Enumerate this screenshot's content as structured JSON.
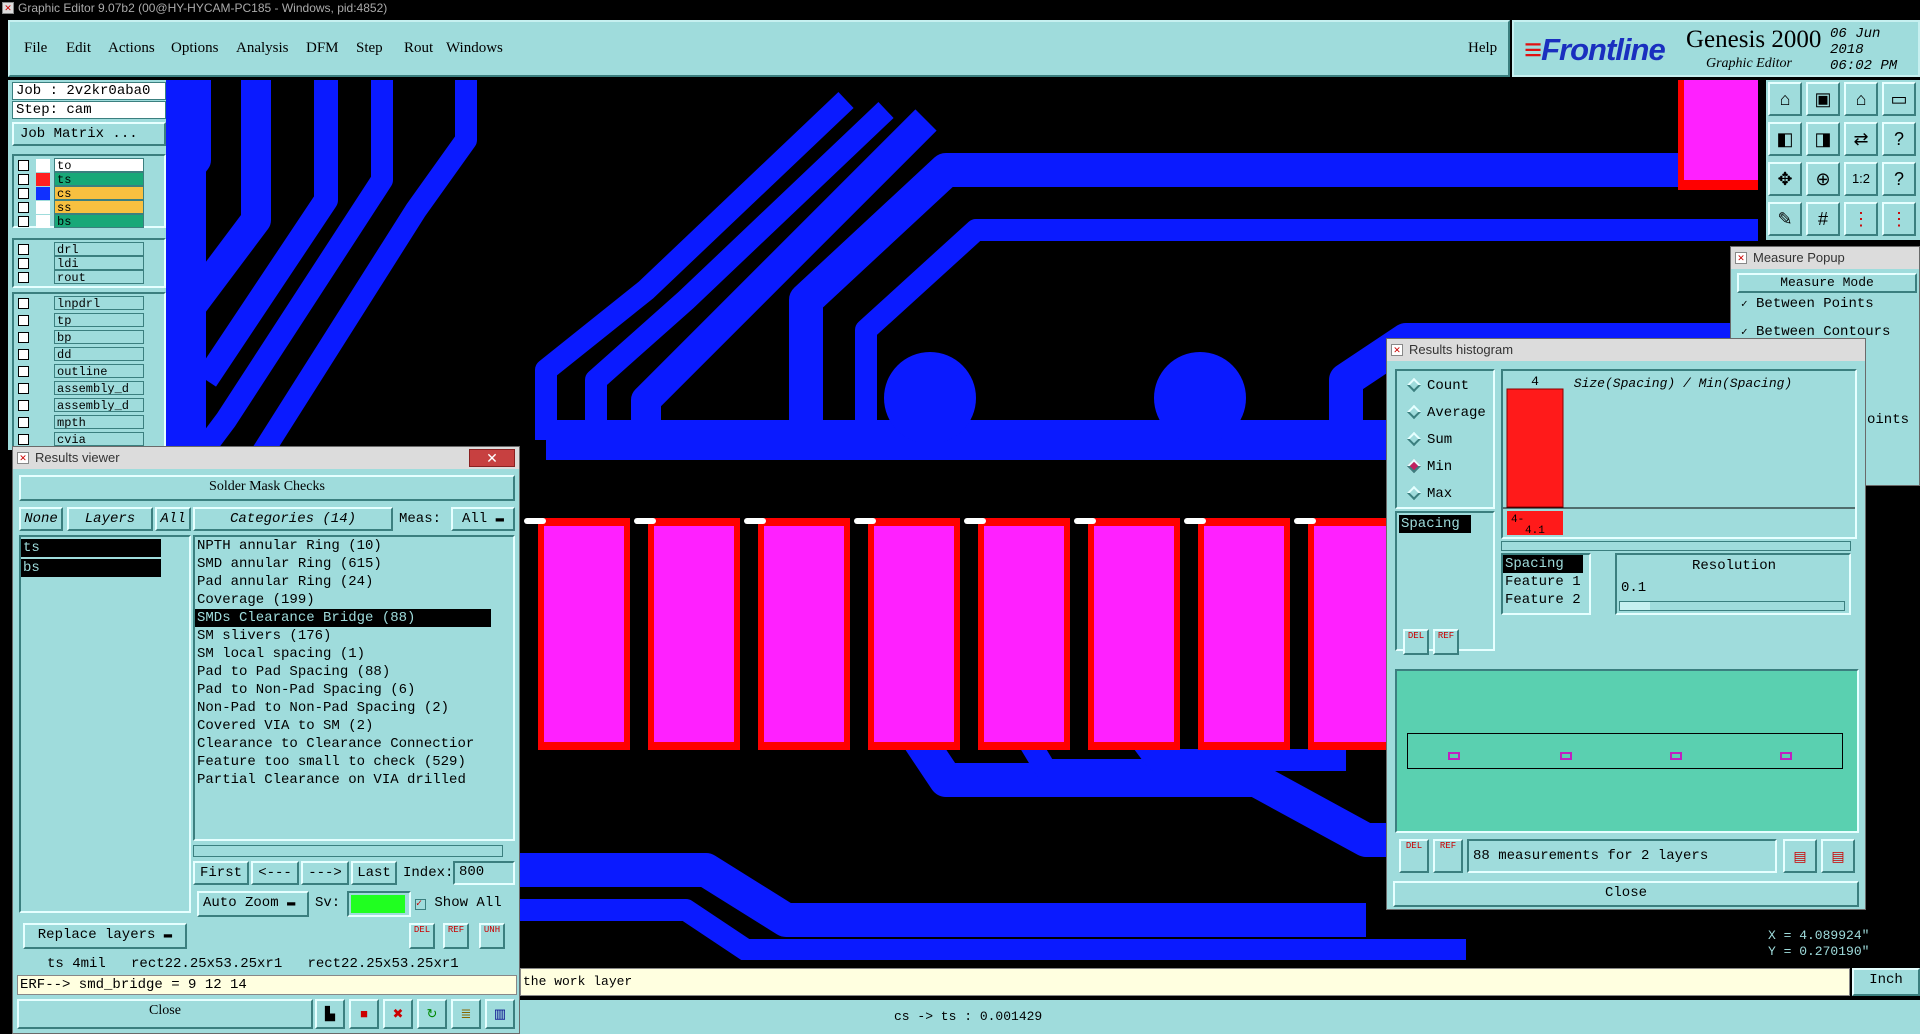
{
  "window_title": "Graphic Editor 9.07b2 (00@HY-HYCAM-PC185 - Windows, pid:4852)",
  "menu": [
    "File",
    "Edit",
    "Actions",
    "Options",
    "Analysis",
    "DFM",
    "Step",
    "Rout",
    "Windows"
  ],
  "help": "Help",
  "brand": {
    "logo": "Frontline",
    "product": "Genesis 2000",
    "subtitle": "Graphic Editor",
    "date": "06 Jun 2018",
    "time": "06:02 PM"
  },
  "job": {
    "job_label": "Job : 2v2kr0aba0",
    "step_label": "Step: cam",
    "matrix_button": "Job Matrix ..."
  },
  "layers_group1": [
    {
      "name": "to",
      "color": "#ffffff",
      "swatch": "#ffffff",
      "row": "#ffffff"
    },
    {
      "name": "ts",
      "color": "#ff0000",
      "swatch": "#ff2020",
      "row": "#18a878"
    },
    {
      "name": "cs",
      "color": "#0000ff",
      "swatch": "#1030ff",
      "row": "#f8c040"
    },
    {
      "name": "ss",
      "color": "#ffff00",
      "swatch": "#ffffff",
      "row": "#f8c040"
    },
    {
      "name": "bs",
      "color": "#18a878",
      "swatch": "#ffffff",
      "row": "#18a878"
    }
  ],
  "layers_group2": [
    "drl",
    "ldi",
    "rout"
  ],
  "layers_group3": [
    "lnpdrl",
    "tp",
    "bp",
    "dd",
    "outline",
    "assembly_d",
    "assembly_d",
    "mpth",
    "cvia"
  ],
  "results_viewer": {
    "title": "Results viewer",
    "header": "Solder Mask Checks",
    "none_btn": "None",
    "layers_btn": "Layers",
    "all_btn": "All",
    "layers": [
      "ts",
      "bs"
    ],
    "categories_label": "Categories (14)",
    "meas_label": "Meas:",
    "meas_value": "All",
    "categories": [
      "NPTH annular Ring (10)",
      "SMD annular Ring (615)",
      "Pad annular Ring (24)",
      "Coverage (199)",
      "SMDs Clearance Bridge (88)",
      "SM slivers (176)",
      "SM local spacing (1)",
      "Pad to Pad Spacing (88)",
      "Pad to Non-Pad Spacing (6)",
      "Non-Pad to Non-Pad Spacing (2)",
      "Covered VIA to SM (2)",
      "Clearance to Clearance Connectior",
      "Feature too small to check (529)",
      "Partial Clearance on VIA drilled"
    ],
    "selected_category": 4,
    "first": "First",
    "prev": "<---",
    "next": "--->",
    "last": "Last",
    "index_label": "Index:",
    "index_value": "800",
    "auto_zoom": "Auto Zoom",
    "sv_label": "Sv:",
    "show_all": "Show All",
    "replace_layers": "Replace layers",
    "info_line": "ts 4mil   rect22.25x53.25xr1   rect22.25x53.25xr1",
    "erf_line": "ERF--> smd_bridge = 9 12 14",
    "close": "Close",
    "del": "DEL",
    "ref": "REF",
    "unh": "UNH"
  },
  "histogram": {
    "title": "Results histogram",
    "modes": [
      "Count",
      "Average",
      "Sum",
      "Min",
      "Max"
    ],
    "selected_mode": "Min",
    "list_item": "Spacing",
    "chart_title": "Size(Spacing) / Min(Spacing)",
    "bar_count_label": "4",
    "bar_range_label_1": "4-",
    "bar_range_label_2": "4.1",
    "field_list": [
      "Spacing",
      "Feature 1",
      "Feature 2"
    ],
    "resolution_label": "Resolution",
    "resolution_value": "0.1",
    "measurements": "88 measurements for 2 layers",
    "close": "Close",
    "del": "DEL",
    "ref": "REF"
  },
  "chart_data": {
    "type": "bar",
    "categories": [
      "4-4.1"
    ],
    "values": [
      4
    ],
    "title": "Size(Spacing) / Min(Spacing)"
  },
  "measure_popup": {
    "title": "Measure Popup",
    "mode_header": "Measure Mode",
    "options": [
      "Between Points",
      "Between Contours"
    ],
    "partial": "oints"
  },
  "coords": {
    "x": "X = 4.089924\"",
    "y": "Y = 0.270190\"",
    "unit": "Inch"
  },
  "status_message": "the work layer",
  "bottom_status": "cs -> ts : 0.001429",
  "colors": {
    "panel": "#9fdcdc",
    "pcb_trace": "#0a1aff",
    "pad": "#ff20ff",
    "mask": "#ff0000"
  }
}
